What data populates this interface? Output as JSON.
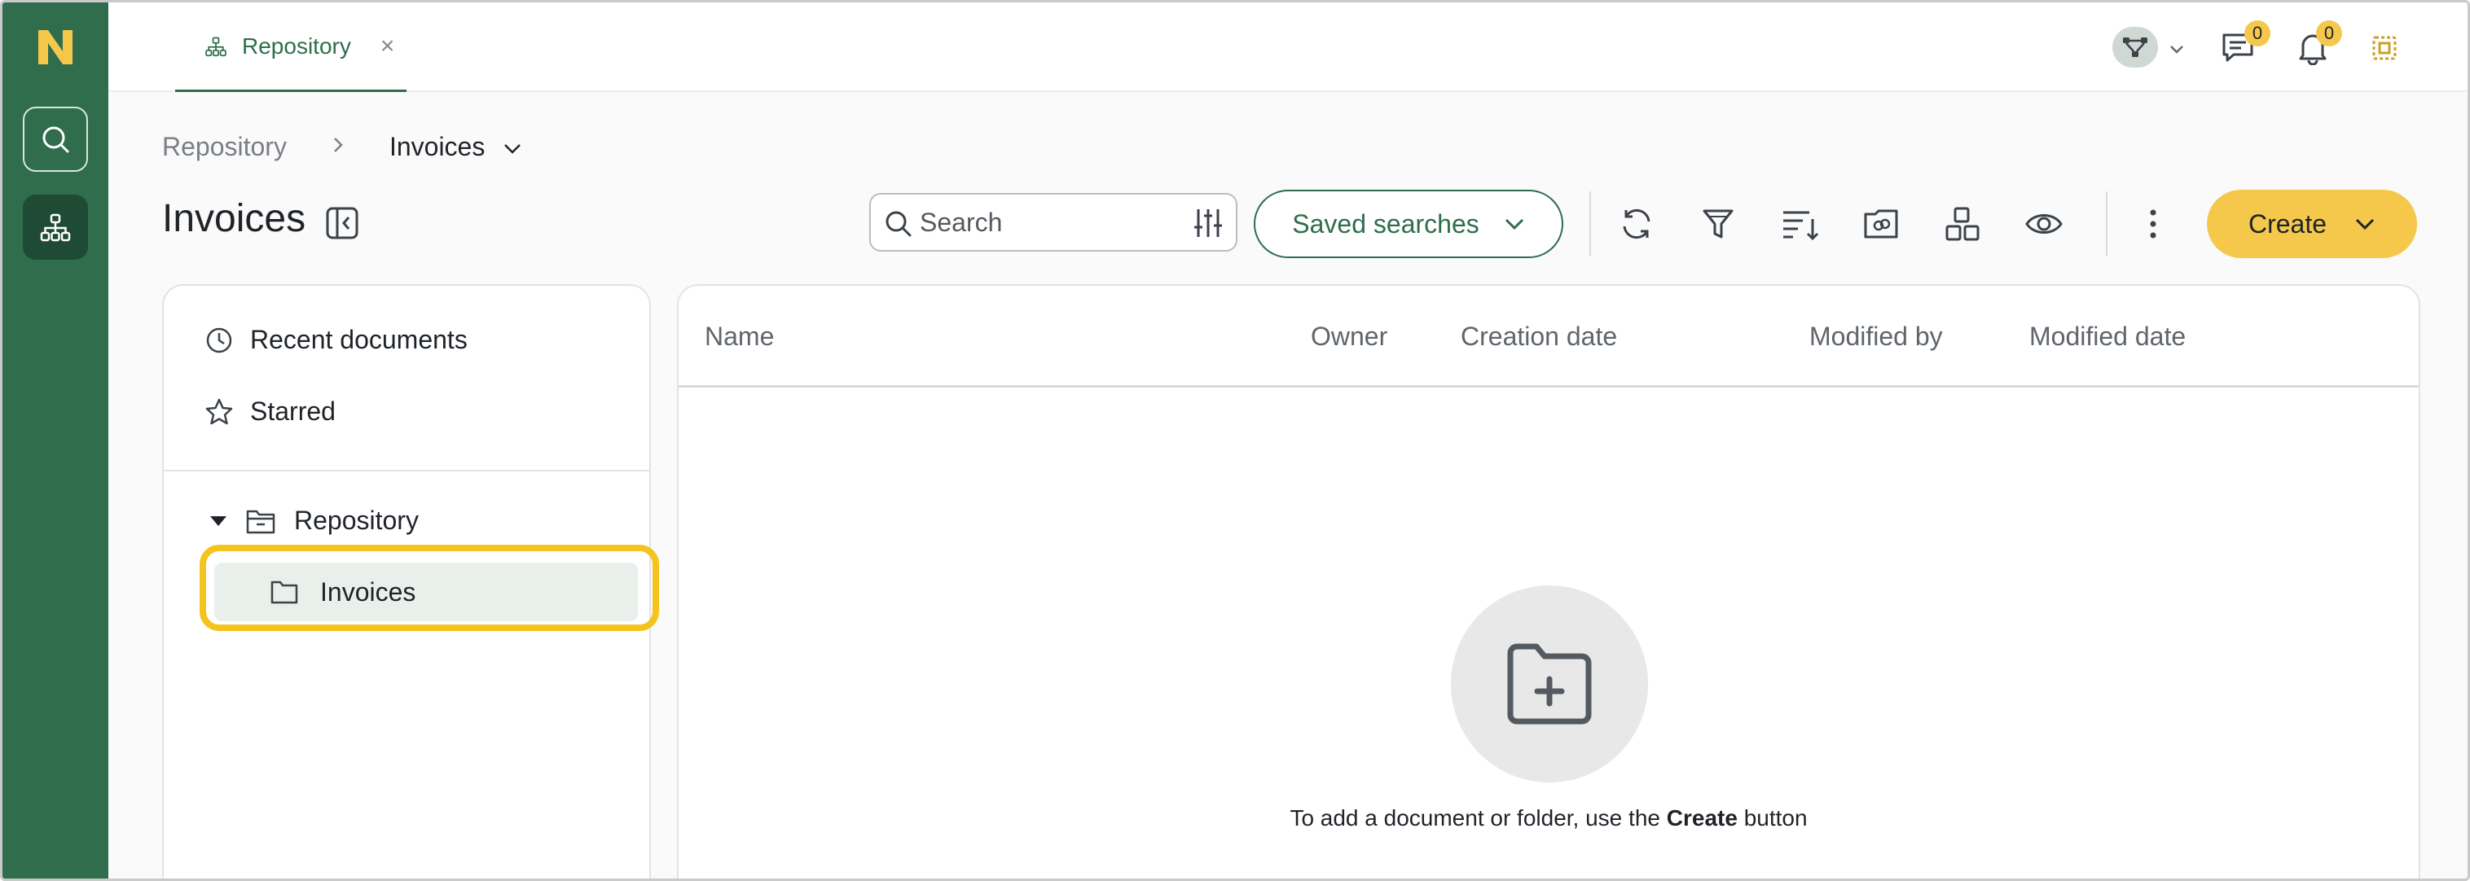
{
  "tabs": [
    {
      "label": "Repository",
      "icon": "sitemap-icon",
      "close": "×"
    }
  ],
  "top_actions": {
    "messages_count": "0",
    "notifications_count": "0"
  },
  "breadcrumb": {
    "root": "Repository",
    "current": "Invoices"
  },
  "page": {
    "title": "Invoices"
  },
  "search": {
    "placeholder": "Search"
  },
  "toolbar": {
    "saved_searches_label": "Saved searches",
    "create_label": "Create"
  },
  "left_panel": {
    "recent_label": "Recent documents",
    "starred_label": "Starred",
    "tree_root_label": "Repository",
    "tree_child_label": "Invoices"
  },
  "table": {
    "columns": [
      "Name",
      "Owner",
      "Creation date",
      "Modified by",
      "Modified date"
    ]
  },
  "empty_state": {
    "text_before": "To add a document or folder, use the ",
    "text_bold": "Create",
    "text_after": " button"
  },
  "colors": {
    "brand_green": "#2f6d4c",
    "accent_yellow": "#f5c84c",
    "highlight_yellow": "#f5c31d"
  }
}
